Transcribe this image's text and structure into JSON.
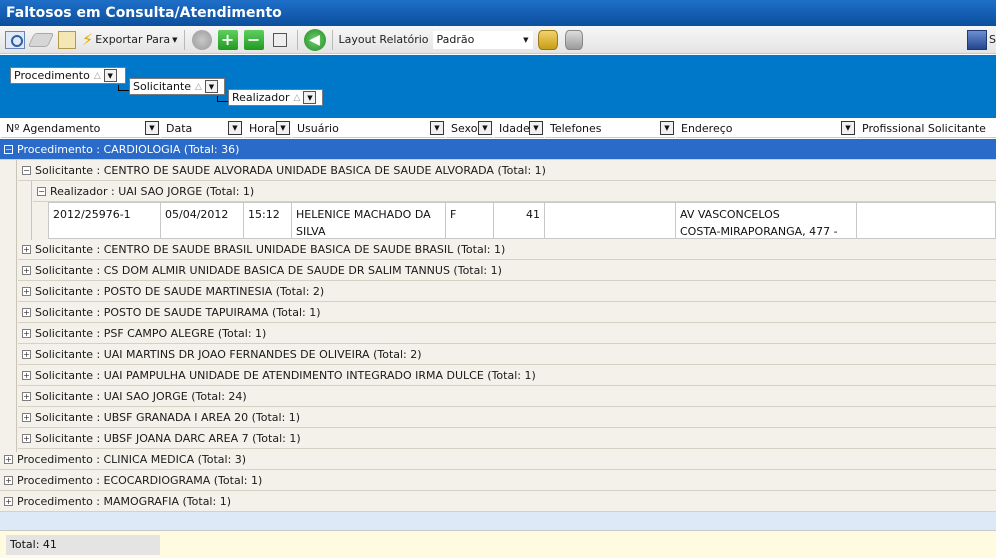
{
  "window": {
    "title": "Faltosos em Consulta/Atendimento"
  },
  "toolbar": {
    "export_label": "Exportar Para",
    "layout_label": "Layout Relatório",
    "layout_value": "Padrão",
    "right_button_label": "S"
  },
  "groupby": {
    "level1": "Procedimento",
    "level2": "Solicitante",
    "level3": "Realizador"
  },
  "columns": {
    "agendamento": "Nº Agendamento",
    "data": "Data",
    "hora": "Hora",
    "usuario": "Usuário",
    "sexo": "Sexo",
    "idade": "Idade",
    "telefones": "Telefones",
    "endereco": "Endereço",
    "profissional": "Profissional Solicitante"
  },
  "rows": [
    {
      "text": "Procedimento : CARDIOLOGIA (Total: 36)"
    },
    {
      "text": "Solicitante : CENTRO DE SAUDE ALVORADA UNIDADE BASICA DE SAUDE ALVORADA (Total: 1)"
    },
    {
      "text": "Realizador : UAI SAO JORGE (Total: 1)"
    },
    {
      "text": "Solicitante : CENTRO DE SAUDE BRASIL UNIDADE BASICA DE SAUDE BRASIL (Total: 1)"
    },
    {
      "text": "Solicitante : CS DOM ALMIR UNIDADE BASICA DE SAUDE DR SALIM TANNUS (Total: 1)"
    },
    {
      "text": "Solicitante : POSTO DE SAUDE MARTINESIA (Total: 2)"
    },
    {
      "text": "Solicitante : POSTO DE SAUDE TAPUIRAMA (Total: 1)"
    },
    {
      "text": "Solicitante : PSF CAMPO ALEGRE (Total: 1)"
    },
    {
      "text": "Solicitante : UAI MARTINS DR JOAO FERNANDES DE OLIVEIRA (Total: 2)"
    },
    {
      "text": "Solicitante : UAI PAMPULHA UNIDADE DE ATENDIMENTO INTEGRADO IRMA DULCE (Total: 1)"
    },
    {
      "text": "Solicitante : UAI SAO JORGE (Total: 24)"
    },
    {
      "text": "Solicitante : UBSF GRANADA I AREA 20 (Total: 1)"
    },
    {
      "text": "Solicitante : UBSF JOANA DARC AREA 7 (Total: 1)"
    },
    {
      "text": "Procedimento : CLINICA MEDICA (Total: 3)"
    },
    {
      "text": "Procedimento : ECOCARDIOGRAMA (Total: 1)"
    },
    {
      "text": "Procedimento : MAMOGRAFIA (Total: 1)"
    }
  ],
  "record": {
    "agendamento": "2012/25976-1",
    "data": "05/04/2012",
    "hora": "15:12",
    "usuario": "HELENICE MACHADO DA SILVA",
    "sexo": "F",
    "idade": "41",
    "telefones": "",
    "endereco_line1": "AV VASCONCELOS",
    "endereco_line2": "COSTA-MIRAPORANGA, 477 -",
    "profissional": ""
  },
  "footer": {
    "total": "Total: 41"
  }
}
